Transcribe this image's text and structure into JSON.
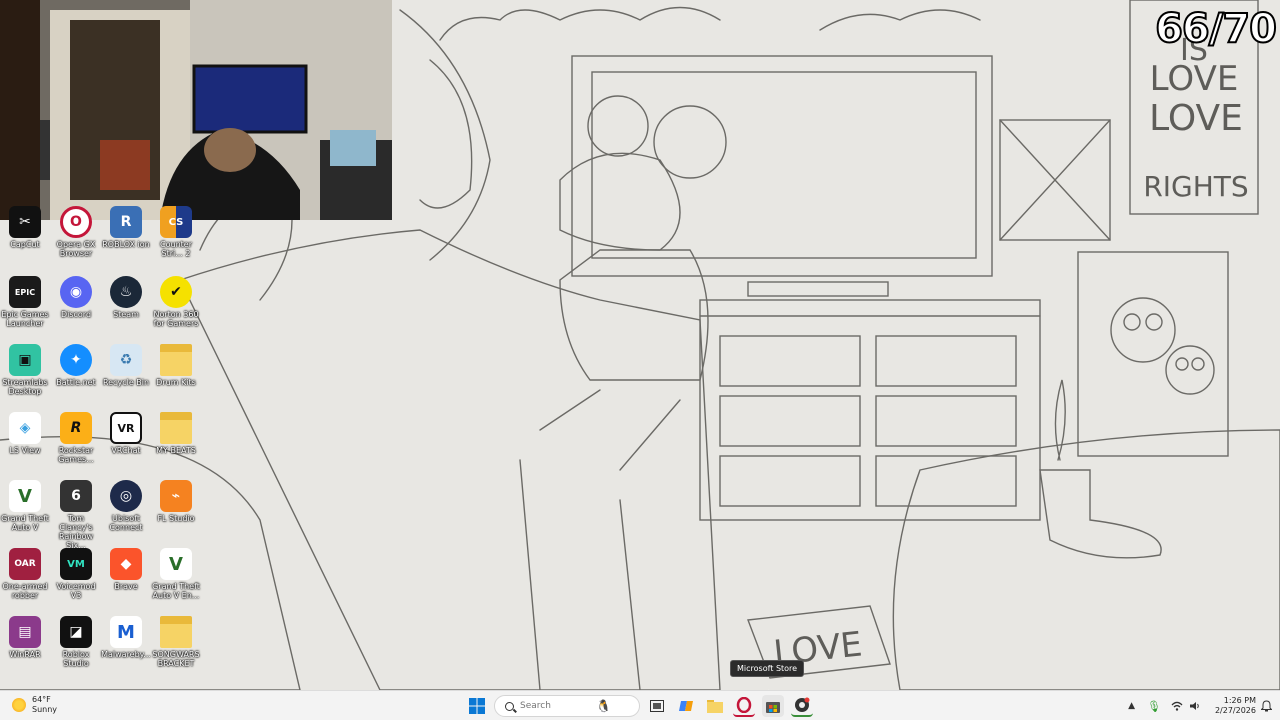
{
  "overlay": {
    "counter": "66/70"
  },
  "wallpaper": {
    "poster_top": [
      "LOVE",
      "IS",
      "LOVE",
      "RIGHTS"
    ],
    "doormat": "LOVE"
  },
  "desktop_icons": [
    {
      "label": "CapCut",
      "color": "#111111",
      "glyph": "✂"
    },
    {
      "label": "Opera GX Browser",
      "color": "#c4163a",
      "glyph": "O"
    },
    {
      "label": "ROBLOX ion",
      "color": "#3a6fb5",
      "glyph": "R"
    },
    {
      "label": "Counter Stri... 2",
      "color": "#f0a020",
      "glyph": "CS"
    },
    {
      "label": "Epic Games Launcher",
      "color": "#1a1a1a",
      "glyph": "EPIC"
    },
    {
      "label": "Discord",
      "color": "#5865f2",
      "glyph": "◉"
    },
    {
      "label": "Steam",
      "color": "#1b2838",
      "glyph": "♨"
    },
    {
      "label": "Norton 360 for Gamers",
      "color": "#f5e100",
      "glyph": "✔"
    },
    {
      "label": "Streamlabs Desktop",
      "color": "#31c3a2",
      "glyph": "▣"
    },
    {
      "label": "Battle.net",
      "color": "#148eff",
      "glyph": "✦"
    },
    {
      "label": "Recycle Bin",
      "color": "#7fb2d8",
      "glyph": "♻"
    },
    {
      "label": "Drum Kits",
      "color": "#f2c94c",
      "glyph": ""
    },
    {
      "label": "LS View",
      "color": "#3aa0e0",
      "glyph": "◈"
    },
    {
      "label": "Rockstar Games...",
      "color": "#fcaf17",
      "glyph": "R"
    },
    {
      "label": "VRChat",
      "color": "#ffffff",
      "glyph": "VR"
    },
    {
      "label": "MY BEATS",
      "color": "#f2c94c",
      "glyph": ""
    },
    {
      "label": "Grand Theft Auto V",
      "color": "#2a6f2a",
      "glyph": "V"
    },
    {
      "label": "Tom Clancy's Rainbow Six...",
      "color": "#333333",
      "glyph": "6"
    },
    {
      "label": "Ubisoft Connect",
      "color": "#1e2a4a",
      "glyph": "◎"
    },
    {
      "label": "FL Studio",
      "color": "#f58220",
      "glyph": "⌁"
    },
    {
      "label": "One-armed robber",
      "color": "#a02040",
      "glyph": "OAR"
    },
    {
      "label": "Voicemod V3",
      "color": "#111111",
      "glyph": "VM"
    },
    {
      "label": "Brave",
      "color": "#fb542b",
      "glyph": "◆"
    },
    {
      "label": "Grand Theft Auto V En...",
      "color": "#2a6f2a",
      "glyph": "V"
    },
    {
      "label": "WinRAR",
      "color": "#8b3a8b",
      "glyph": "▤"
    },
    {
      "label": "Roblox Studio",
      "color": "#111111",
      "glyph": "◪"
    },
    {
      "label": "Malwareby...",
      "color": "#1a5fd1",
      "glyph": "M"
    },
    {
      "label": "SONGWARS BRACKET",
      "color": "#f2c94c",
      "glyph": ""
    }
  ],
  "taskbar": {
    "weather_temp": "64°F",
    "weather_desc": "Sunny",
    "search_placeholder": "Search",
    "time": "1:26 PM",
    "date": "2/27/2026"
  },
  "tooltip": "Microsoft Store"
}
